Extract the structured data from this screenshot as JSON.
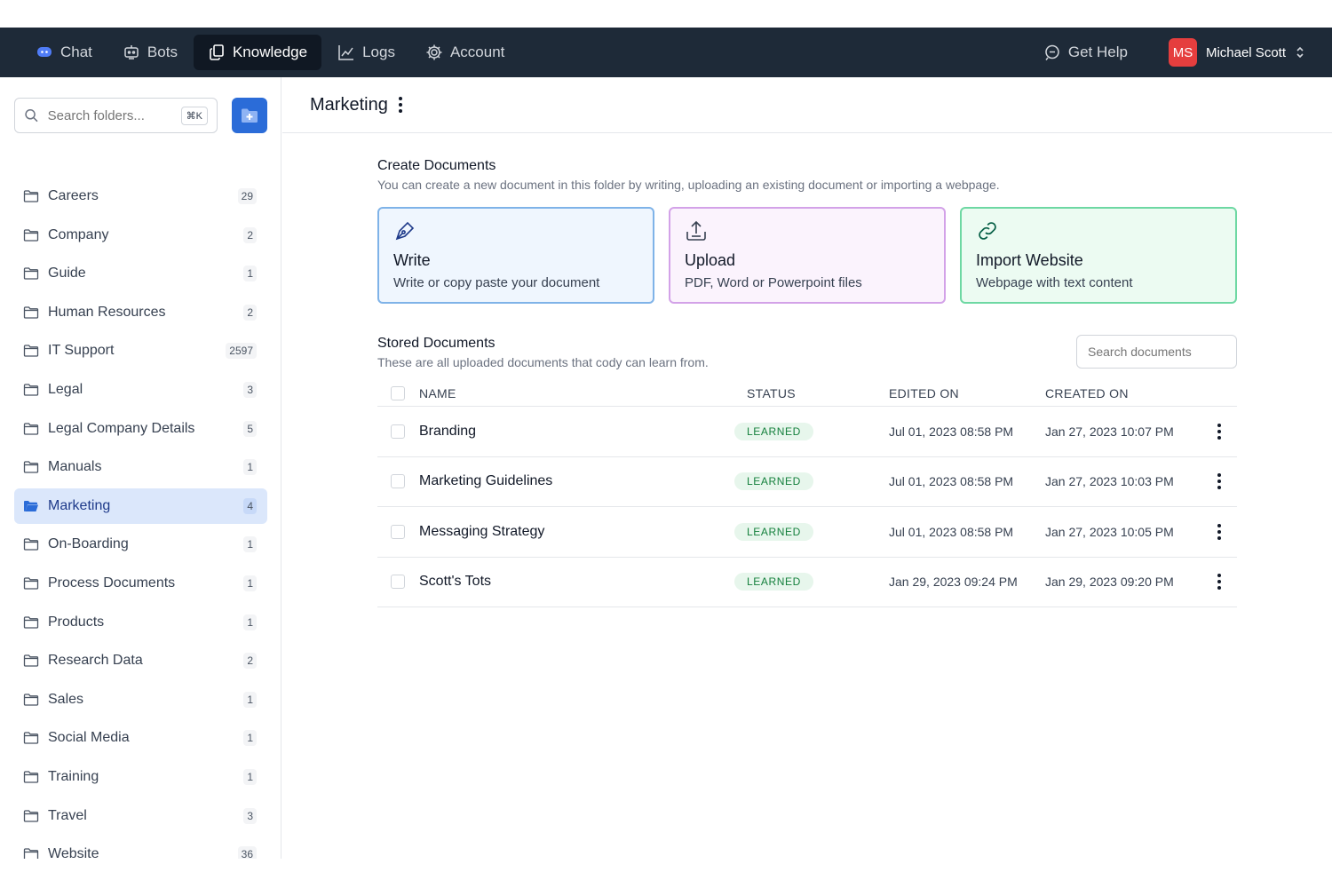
{
  "nav": {
    "items": [
      {
        "label": "Chat",
        "icon": "chat-bubble-icon",
        "active": false
      },
      {
        "label": "Bots",
        "icon": "bot-icon",
        "active": false
      },
      {
        "label": "Knowledge",
        "icon": "copy-documents-icon",
        "active": true
      },
      {
        "label": "Logs",
        "icon": "line-chart-icon",
        "active": false
      },
      {
        "label": "Account",
        "icon": "gear-icon",
        "active": false
      }
    ],
    "help_label": "Get Help",
    "user": {
      "initials": "MS",
      "name": "Michael Scott"
    }
  },
  "sidebar": {
    "search_placeholder": "Search folders...",
    "shortcut": "⌘K",
    "folders": [
      {
        "name": "Careers",
        "count": "29"
      },
      {
        "name": "Company",
        "count": "2"
      },
      {
        "name": "Guide",
        "count": "1"
      },
      {
        "name": "Human Resources",
        "count": "2"
      },
      {
        "name": "IT Support",
        "count": "2597"
      },
      {
        "name": "Legal",
        "count": "3"
      },
      {
        "name": "Legal Company Details",
        "count": "5"
      },
      {
        "name": "Manuals",
        "count": "1"
      },
      {
        "name": "Marketing",
        "count": "4"
      },
      {
        "name": "On-Boarding",
        "count": "1"
      },
      {
        "name": "Process Documents",
        "count": "1"
      },
      {
        "name": "Products",
        "count": "1"
      },
      {
        "name": "Research Data",
        "count": "2"
      },
      {
        "name": "Sales",
        "count": "1"
      },
      {
        "name": "Social Media",
        "count": "1"
      },
      {
        "name": "Training",
        "count": "1"
      },
      {
        "name": "Travel",
        "count": "3"
      },
      {
        "name": "Website",
        "count": "36"
      }
    ]
  },
  "main": {
    "folder_title": "Marketing",
    "create": {
      "title": "Create Documents",
      "description": "You can create a new document in this folder by writing, uploading an existing document or importing a webpage.",
      "cards": {
        "write": {
          "title": "Write",
          "desc": "Write or copy paste your document"
        },
        "upload": {
          "title": "Upload",
          "desc": "PDF, Word or Powerpoint files"
        },
        "import": {
          "title": "Import Website",
          "desc": "Webpage with text content"
        }
      }
    },
    "stored": {
      "title": "Stored Documents",
      "description": "These are all uploaded documents that cody can learn from.",
      "search_placeholder": "Search documents",
      "columns": {
        "name": "NAME",
        "status": "STATUS",
        "edited": "EDITED ON",
        "created": "CREATED ON"
      },
      "rows": [
        {
          "name": "Branding",
          "status": "LEARNED",
          "edited": "Jul 01, 2023 08:58 PM",
          "created": "Jan 27, 2023 10:07 PM"
        },
        {
          "name": "Marketing Guidelines",
          "status": "LEARNED",
          "edited": "Jul 01, 2023 08:58 PM",
          "created": "Jan 27, 2023 10:03 PM"
        },
        {
          "name": "Messaging Strategy",
          "status": "LEARNED",
          "edited": "Jul 01, 2023 08:58 PM",
          "created": "Jan 27, 2023 10:05 PM"
        },
        {
          "name": "Scott's Tots",
          "status": "LEARNED",
          "edited": "Jan 29, 2023 09:24 PM",
          "created": "Jan 29, 2023 09:20 PM"
        }
      ]
    }
  },
  "colors": {
    "topbar": "#1e2a38",
    "accent": "#2b6cd8",
    "active_folder": "#dbe7fb",
    "learned": "#15803d"
  }
}
